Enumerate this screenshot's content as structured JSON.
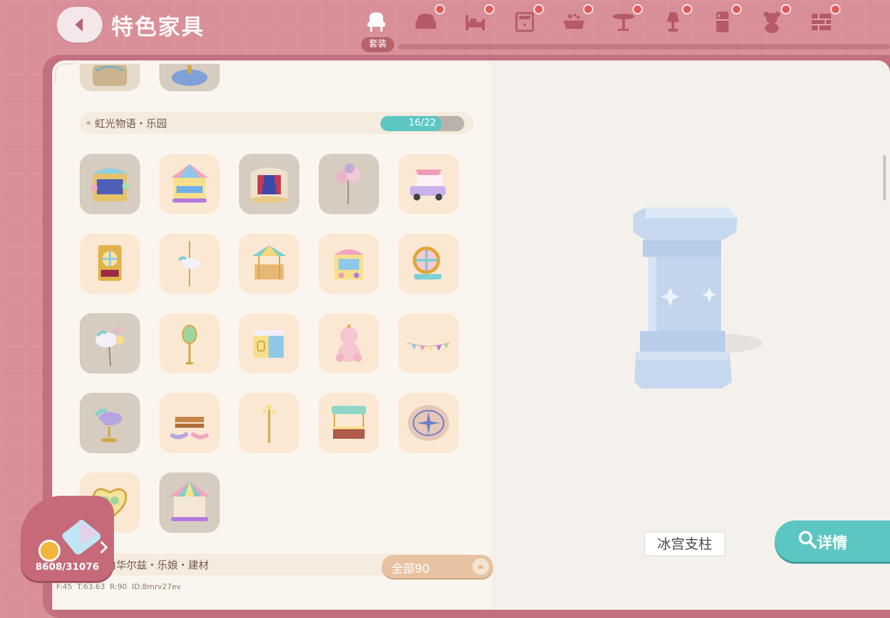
{
  "header": {
    "title": "特色家具",
    "tabs": [
      {
        "icon": "suit-chair-icon",
        "label": "套装",
        "active": true,
        "badge": false
      },
      {
        "icon": "armchair-icon",
        "badge": true
      },
      {
        "icon": "bed-icon",
        "badge": true
      },
      {
        "icon": "cabinet-icon",
        "badge": true
      },
      {
        "icon": "bathtub-icon",
        "badge": true
      },
      {
        "icon": "table-icon",
        "badge": true
      },
      {
        "icon": "lamp-icon",
        "badge": true
      },
      {
        "icon": "fridge-icon",
        "badge": true
      },
      {
        "icon": "teddy-bear-icon",
        "badge": true
      },
      {
        "icon": "brick-wall-icon",
        "badge": true
      }
    ]
  },
  "sections": [
    {
      "title": "虹光物语・乐园",
      "progress_text": "16/22",
      "progress": 0.727,
      "items": [
        {
          "name": "game-booth",
          "bg": "grey"
        },
        {
          "name": "carousel",
          "bg": "cream"
        },
        {
          "name": "stage",
          "bg": "grey"
        },
        {
          "name": "balloon-bunch",
          "bg": "grey"
        },
        {
          "name": "candy-truck",
          "bg": "cream"
        },
        {
          "name": "claw-cabinet",
          "bg": "cream"
        },
        {
          "name": "carousel-pony-pole",
          "bg": "cream"
        },
        {
          "name": "mini-carousel",
          "bg": "cream"
        },
        {
          "name": "arcade-machine",
          "bg": "cream"
        },
        {
          "name": "wheel-of-fortune",
          "bg": "cream"
        },
        {
          "name": "unicorn-balloons",
          "bg": "grey"
        },
        {
          "name": "signpost",
          "bg": "cream"
        },
        {
          "name": "ticket-box",
          "bg": "cream"
        },
        {
          "name": "unicorn-plush",
          "bg": "cream"
        },
        {
          "name": "bunting-flags",
          "bg": "cream"
        },
        {
          "name": "spring-rider",
          "bg": "grey"
        },
        {
          "name": "rocking-bench",
          "bg": "cream"
        },
        {
          "name": "street-lamp",
          "bg": "cream"
        },
        {
          "name": "snack-stall",
          "bg": "cream"
        },
        {
          "name": "compass-rug",
          "bg": "cream"
        },
        {
          "name": "heart-mirror",
          "bg": "cream"
        },
        {
          "name": "big-carousel",
          "bg": "grey"
        }
      ]
    },
    {
      "title": "由华尔兹・乐娘・建材"
    }
  ],
  "currency": {
    "amount": "8608/31076",
    "icon": "puzzle-piece-icon"
  },
  "filter": {
    "label": "全部90"
  },
  "debug_text": "F:45  T:63.63  R:90  ID:8mrv27ev",
  "preview": {
    "item_name": "冰宫支柱",
    "icon": "ice-pillar"
  },
  "detail": {
    "label": "详情"
  },
  "colors": {
    "accent": "#5cc6c2",
    "header_bg": "#d98f98",
    "badge": "#e05a5a"
  }
}
